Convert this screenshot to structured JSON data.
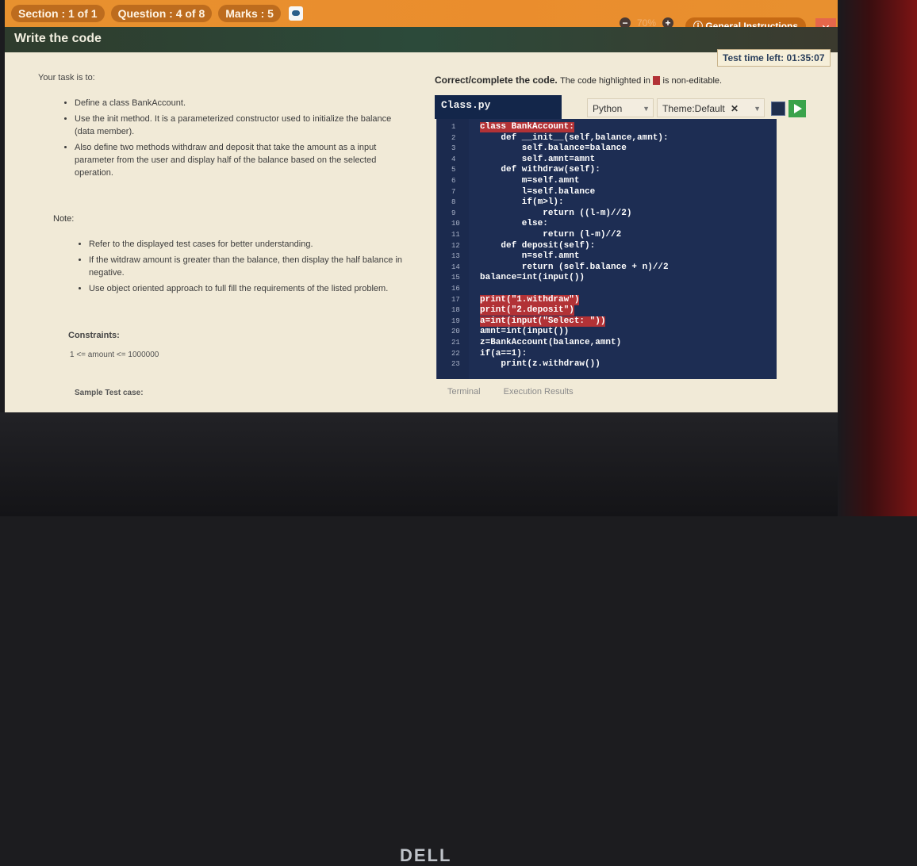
{
  "topbar": {
    "section": "Section : 1 of 1",
    "question": "Question : 4 of 8",
    "marks": "Marks : 5",
    "zoom": "70%",
    "general_instructions": "General Instructions"
  },
  "window_title": "Write the code",
  "timer": "Test time left: 01:35:07",
  "task": {
    "heading": "Your task is to:",
    "items": [
      "Define a class BankAccount.",
      "Use the init method. It is a parameterized constructor used to initialize the balance (data member).",
      "Also define two methods withdraw and deposit that take the amount as a input parameter from the user and display half of the balance based on the selected operation."
    ]
  },
  "note": {
    "label": "Note:",
    "items": [
      "Refer to the displayed test cases for better understanding.",
      "If the witdraw amount is greater than the balance, then display the half balance in negative.",
      "Use object oriented approach to full fill the requirements of the listed problem."
    ]
  },
  "constraints": {
    "label": "Constraints:",
    "value": "1 <= amount <= 1000000"
  },
  "sample": "Sample Test case:",
  "editor": {
    "instruction": "Correct/complete the code.",
    "note_prefix": "The code highlighted in",
    "note_suffix": "is non-editable.",
    "filename": "Class.py",
    "language": "Python",
    "theme": "Theme:Default",
    "lines": [
      {
        "n": "1",
        "text": "class BankAccount:",
        "hl": true
      },
      {
        "n": "2",
        "text": "    def __init__(self,balance,amnt):",
        "hl": false
      },
      {
        "n": "3",
        "text": "        self.balance=balance",
        "hl": false
      },
      {
        "n": "4",
        "text": "        self.amnt=amnt",
        "hl": false
      },
      {
        "n": "5",
        "text": "    def withdraw(self):",
        "hl": false
      },
      {
        "n": "6",
        "text": "        m=self.amnt",
        "hl": false
      },
      {
        "n": "7",
        "text": "        l=self.balance",
        "hl": false
      },
      {
        "n": "8",
        "text": "        if(m>l):",
        "hl": false
      },
      {
        "n": "9",
        "text": "            return ((l-m)//2)",
        "hl": false
      },
      {
        "n": "10",
        "text": "        else:",
        "hl": false
      },
      {
        "n": "11",
        "text": "            return (l-m)//2",
        "hl": false
      },
      {
        "n": "12",
        "text": "    def deposit(self):",
        "hl": false
      },
      {
        "n": "13",
        "text": "        n=self.amnt",
        "hl": false
      },
      {
        "n": "14",
        "text": "        return (self.balance + n)//2",
        "hl": false
      },
      {
        "n": "15",
        "text": "balance=int(input())",
        "hl": false
      },
      {
        "n": "16",
        "text": "",
        "hl": false
      },
      {
        "n": "17",
        "text": "print(\"1.withdraw\")",
        "hl": true
      },
      {
        "n": "18",
        "text": "print(\"2.deposit\")",
        "hl": true
      },
      {
        "n": "19",
        "text": "a=int(input(\"Select: \"))",
        "hl": true
      },
      {
        "n": "20",
        "text": "amnt=int(input())",
        "hl": false
      },
      {
        "n": "21",
        "text": "z=BankAccount(balance,amnt)",
        "hl": false
      },
      {
        "n": "22",
        "text": "if(a==1):",
        "hl": false
      },
      {
        "n": "23",
        "text": "    print(z.withdraw())",
        "hl": false
      }
    ]
  },
  "bottom_tabs": [
    "Terminal",
    "Execution Results"
  ],
  "logo": "DELL"
}
